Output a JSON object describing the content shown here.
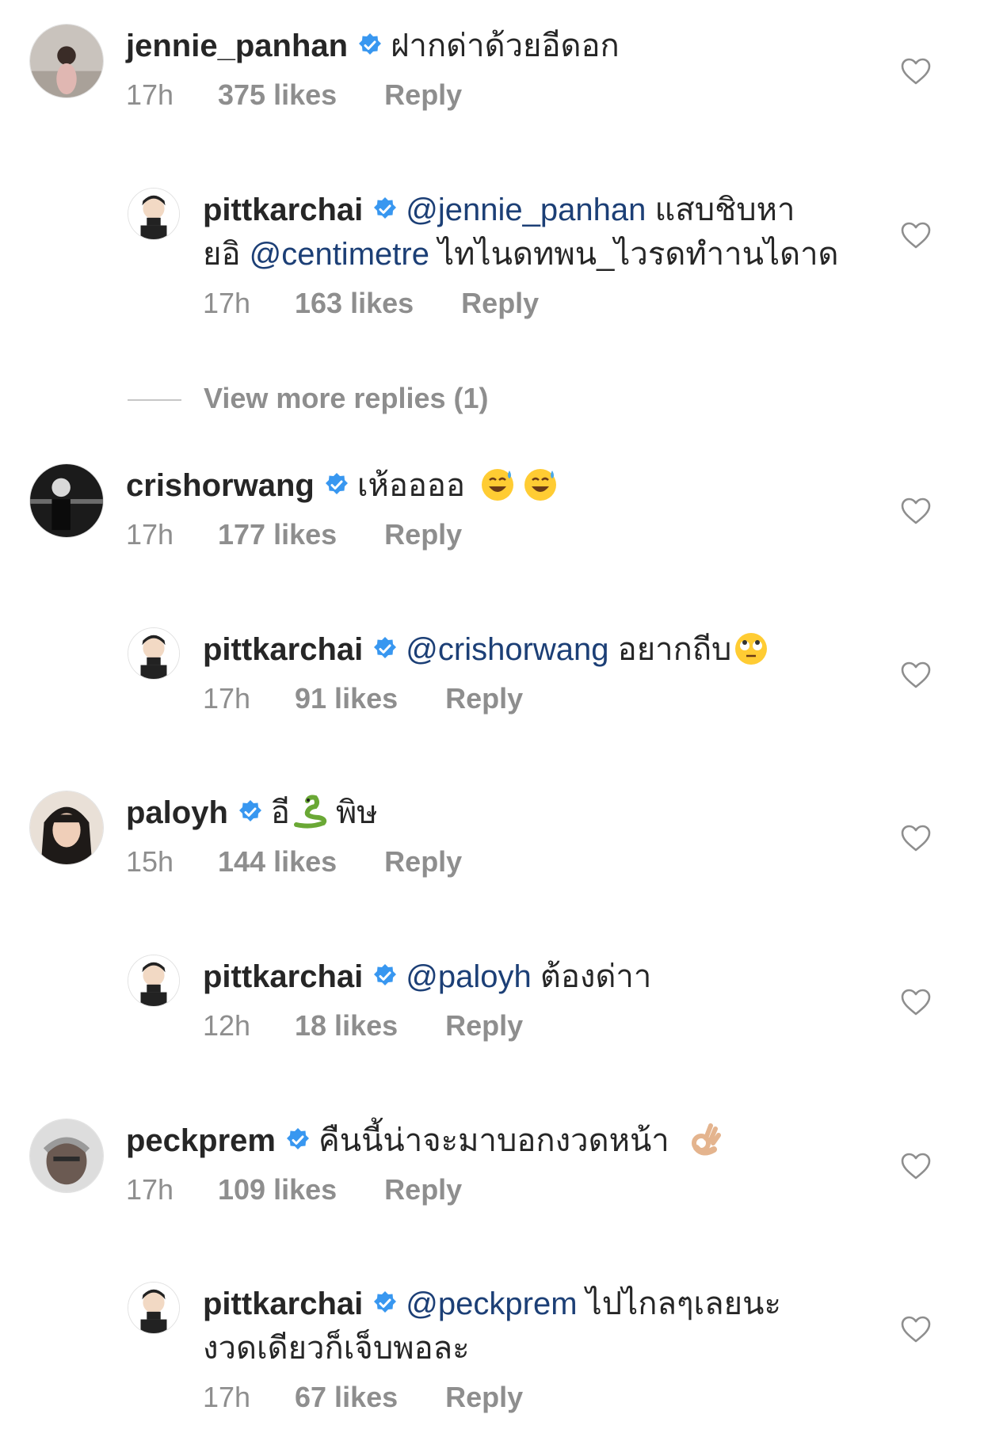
{
  "comments": [
    {
      "username": "jennie_panhan",
      "text": "ฝากด่าด้วยอีดอก",
      "time": "17h",
      "likes": "375 likes",
      "reply": "Reply",
      "avatar": "avatar-photo",
      "replies": [
        {
          "username": "pittkarchai",
          "mention": "@jennie_panhan",
          "text": "แสบชิบหา",
          "line2_prefix": "ยอิ",
          "mention2": "@centimetre",
          "line2_text": "ไทไนดทพน_ไวรดทำานไดาด",
          "time": "17h",
          "likes": "163 likes",
          "reply": "Reply"
        }
      ],
      "view_more": "View more replies (1)"
    },
    {
      "username": "crishorwang",
      "text": "เห้ออออ",
      "emoji": [
        "sweat-smile-emoji",
        "sweat-smile-emoji"
      ],
      "time": "17h",
      "likes": "177 likes",
      "reply": "Reply",
      "replies": [
        {
          "username": "pittkarchai",
          "mention": "@crishorwang",
          "text": "อยากถีบ",
          "emoji": "rolling-eyes-emoji",
          "time": "17h",
          "likes": "91 likes",
          "reply": "Reply"
        }
      ]
    },
    {
      "username": "paloyh",
      "text_before": "อี",
      "emoji": "snake-emoji",
      "text": "พิษ",
      "time": "15h",
      "likes": "144 likes",
      "reply": "Reply",
      "replies": [
        {
          "username": "pittkarchai",
          "mention": "@paloyh",
          "text": "ต้องด่าา",
          "time": "12h",
          "likes": "18 likes",
          "reply": "Reply"
        }
      ]
    },
    {
      "username": "peckprem",
      "text": "คืนนี้น่าจะมาบอกงวดหน้า",
      "emoji": "ok-hand-emoji",
      "time": "17h",
      "likes": "109 likes",
      "reply": "Reply",
      "replies": [
        {
          "username": "pittkarchai",
          "mention": "@peckprem",
          "text": "ไปไกลๆเลยนะ",
          "line2_text": "งวดเดียวก็เจ็บพอละ",
          "time": "17h",
          "likes": "67 likes",
          "reply": "Reply"
        }
      ]
    }
  ],
  "colors": {
    "username": "#262626",
    "mention": "#1c3f76",
    "meta": "#8e8e8e",
    "verified": "#3897f0",
    "heart": "#8e8e8e"
  },
  "icons": {
    "verified": "verified-badge-icon",
    "like": "heart-icon"
  }
}
